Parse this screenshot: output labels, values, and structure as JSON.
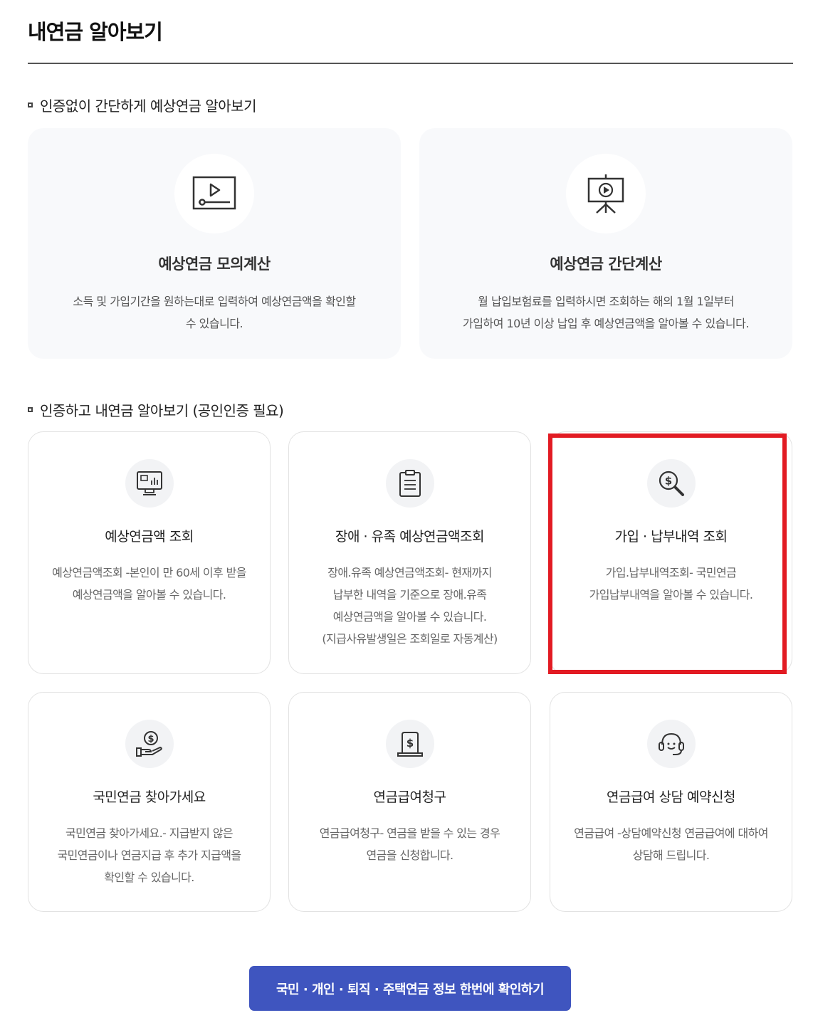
{
  "page": {
    "title": "내연금 알아보기"
  },
  "sections": {
    "no_auth": {
      "heading": "인증없이 간단하게 예상연금 알아보기"
    },
    "auth": {
      "heading": "인증하고 내연금 알아보기 (공인인증 필요)"
    }
  },
  "big_cards": [
    {
      "icon": "video-player-icon",
      "title": "예상연금 모의계산",
      "desc_line1": "소득 및 가입기간을 원하는대로 입력하여 예상연금액을 확인할",
      "desc_line2": "수 있습니다."
    },
    {
      "icon": "presentation-board-icon",
      "title": "예상연금 간단계산",
      "desc_line1": "월 납입보험료를 입력하시면 조회하는 해의 1월 1일부터",
      "desc_line2": "가입하여 10년 이상 납입 후 예상연금액을 알아볼 수 있습니다."
    }
  ],
  "small_cards": [
    {
      "icon": "monitor-chart-icon",
      "title": "예상연금액 조회",
      "desc": [
        "예상연금액조회 -본인이 만 60세 이후 받을",
        "예상연금액을 알아볼 수 있습니다."
      ]
    },
    {
      "icon": "clipboard-list-icon",
      "title": "장애 · 유족 예상연금액조회",
      "desc": [
        "장애.유족 예상연금액조회- 현재까지",
        "납부한 내역을 기준으로 장애.유족",
        "예상연금액을 알아볼 수 있습니다.",
        "(지급사유발생일은 조회일로 자동계산)"
      ]
    },
    {
      "icon": "dollar-search-icon",
      "title": "가입 · 납부내역 조회",
      "desc": [
        "가입.납부내역조회- 국민연금",
        "가입납부내역을 알아볼 수 있습니다."
      ]
    },
    {
      "icon": "dollar-hand-icon",
      "title": "국민연금 찾아가세요",
      "desc": [
        "국민연금 찾아가세요.- 지급받지 않은",
        "국민연금이나 연금지급 후 추가 지급액을",
        "확인할 수 있습니다."
      ]
    },
    {
      "icon": "dollar-document-icon",
      "title": "연금급여청구",
      "desc": [
        "연금급여청구- 연금을 받을 수 있는 경우",
        "연금을 신청합니다."
      ]
    },
    {
      "icon": "headset-icon",
      "title": "연금급여 상담 예약신청",
      "desc": [
        "연금급여 -상담예약신청 연금급여에 대하여",
        "상담해 드립니다."
      ]
    }
  ],
  "cta": {
    "label": "국민 · 개인 · 퇴직 · 주택연금 정보 한번에 확인하기"
  },
  "colors": {
    "accent": "#3f55bf",
    "highlight": "#e21b23",
    "card_bg": "#f8f9fb"
  }
}
